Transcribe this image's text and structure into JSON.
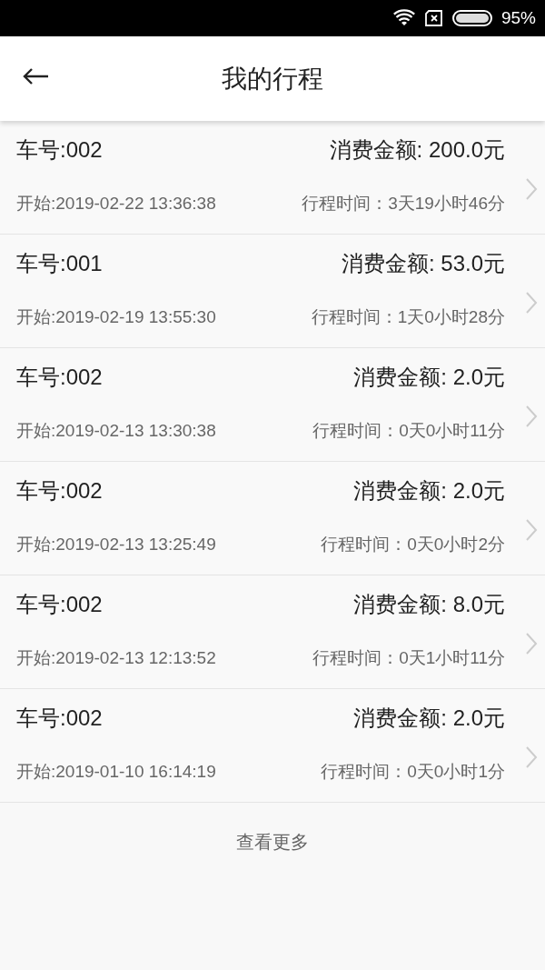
{
  "status_bar": {
    "battery": "95%"
  },
  "header": {
    "title": "我的行程"
  },
  "trips": [
    {
      "car": "车号:002",
      "amount": "消费金额: 200.0元",
      "start": "开始:2019-02-22 13:36:38",
      "duration": "行程时间：3天19小时46分"
    },
    {
      "car": "车号:001",
      "amount": "消费金额: 53.0元",
      "start": "开始:2019-02-19 13:55:30",
      "duration": "行程时间：1天0小时28分"
    },
    {
      "car": "车号:002",
      "amount": "消费金额: 2.0元",
      "start": "开始:2019-02-13 13:30:38",
      "duration": "行程时间：0天0小时11分"
    },
    {
      "car": "车号:002",
      "amount": "消费金额: 2.0元",
      "start": "开始:2019-02-13 13:25:49",
      "duration": "行程时间：0天0小时2分"
    },
    {
      "car": "车号:002",
      "amount": "消费金额: 8.0元",
      "start": "开始:2019-02-13 12:13:52",
      "duration": "行程时间：0天1小时11分"
    },
    {
      "car": "车号:002",
      "amount": "消费金额: 2.0元",
      "start": "开始:2019-01-10 16:14:19",
      "duration": "行程时间：0天0小时1分"
    }
  ],
  "more_link": "查看更多"
}
